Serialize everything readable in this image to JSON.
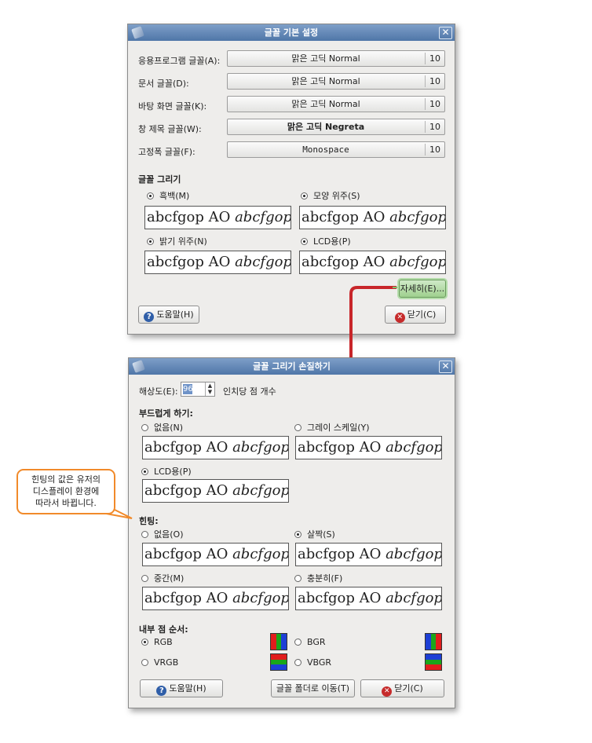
{
  "dialog1": {
    "title": "글꼴 기본 설정",
    "fonts": [
      {
        "label": "응용프로그램 글꼴(A):",
        "name": "맑은 고딕 Normal",
        "size": "10"
      },
      {
        "label": "문서 글꼴(D):",
        "name": "맑은 고딕 Normal",
        "size": "10"
      },
      {
        "label": "바탕 화면 글꼴(K):",
        "name": "맑은 고딕 Normal",
        "size": "10"
      },
      {
        "label": "창 제목 글꼴(W):",
        "name": "맑은 고딕 Negreta",
        "size": "10"
      },
      {
        "label": "고정폭 글꼴(F):",
        "name": "Monospace",
        "size": "10"
      }
    ],
    "rendering_title": "글꼴 그리기",
    "options": [
      "흑백(M)",
      "모양 위주(S)",
      "밝기 위주(N)",
      "LCD용(P)"
    ],
    "sample_regular": "abcfgop AO ",
    "sample_italic": "abcfgop",
    "details_button": "자세히(E)...",
    "help_button": "도움말(H)",
    "close_button": "닫기(C)"
  },
  "dialog2": {
    "title": "글꼴 그리기 손질하기",
    "resolution_label": "해상도(E):",
    "resolution_value": "96",
    "resolution_unit": "인치당 점 개수",
    "smoothing_title": "부드럽게 하기:",
    "smoothing_options": [
      "없음(N)",
      "그레이 스케일(Y)",
      "LCD용(P)"
    ],
    "hinting_title": "힌팅:",
    "hinting_options": [
      "없음(O)",
      "살짝(S)",
      "중간(M)",
      "충분히(F)"
    ],
    "subpixel_title": "내부 점 순서:",
    "subpixel_options": [
      "RGB",
      "BGR",
      "VRGB",
      "VBGR"
    ],
    "help_button": "도움말(H)",
    "goto_folder_button": "글꼴 폴더로 이동(T)",
    "close_button": "닫기(C)"
  },
  "callout": {
    "line1": "힌팅의 값은 유저의",
    "line2": "디스플레이 환경에",
    "line3": "따라서 바뀝니다."
  },
  "colors": {
    "annotation_arrow": "#c8262a",
    "callout_border": "#f18a2a",
    "titlebar": "#5b80b0"
  },
  "icons": {
    "help": "help-circle-icon",
    "close": "close-circle-icon"
  }
}
